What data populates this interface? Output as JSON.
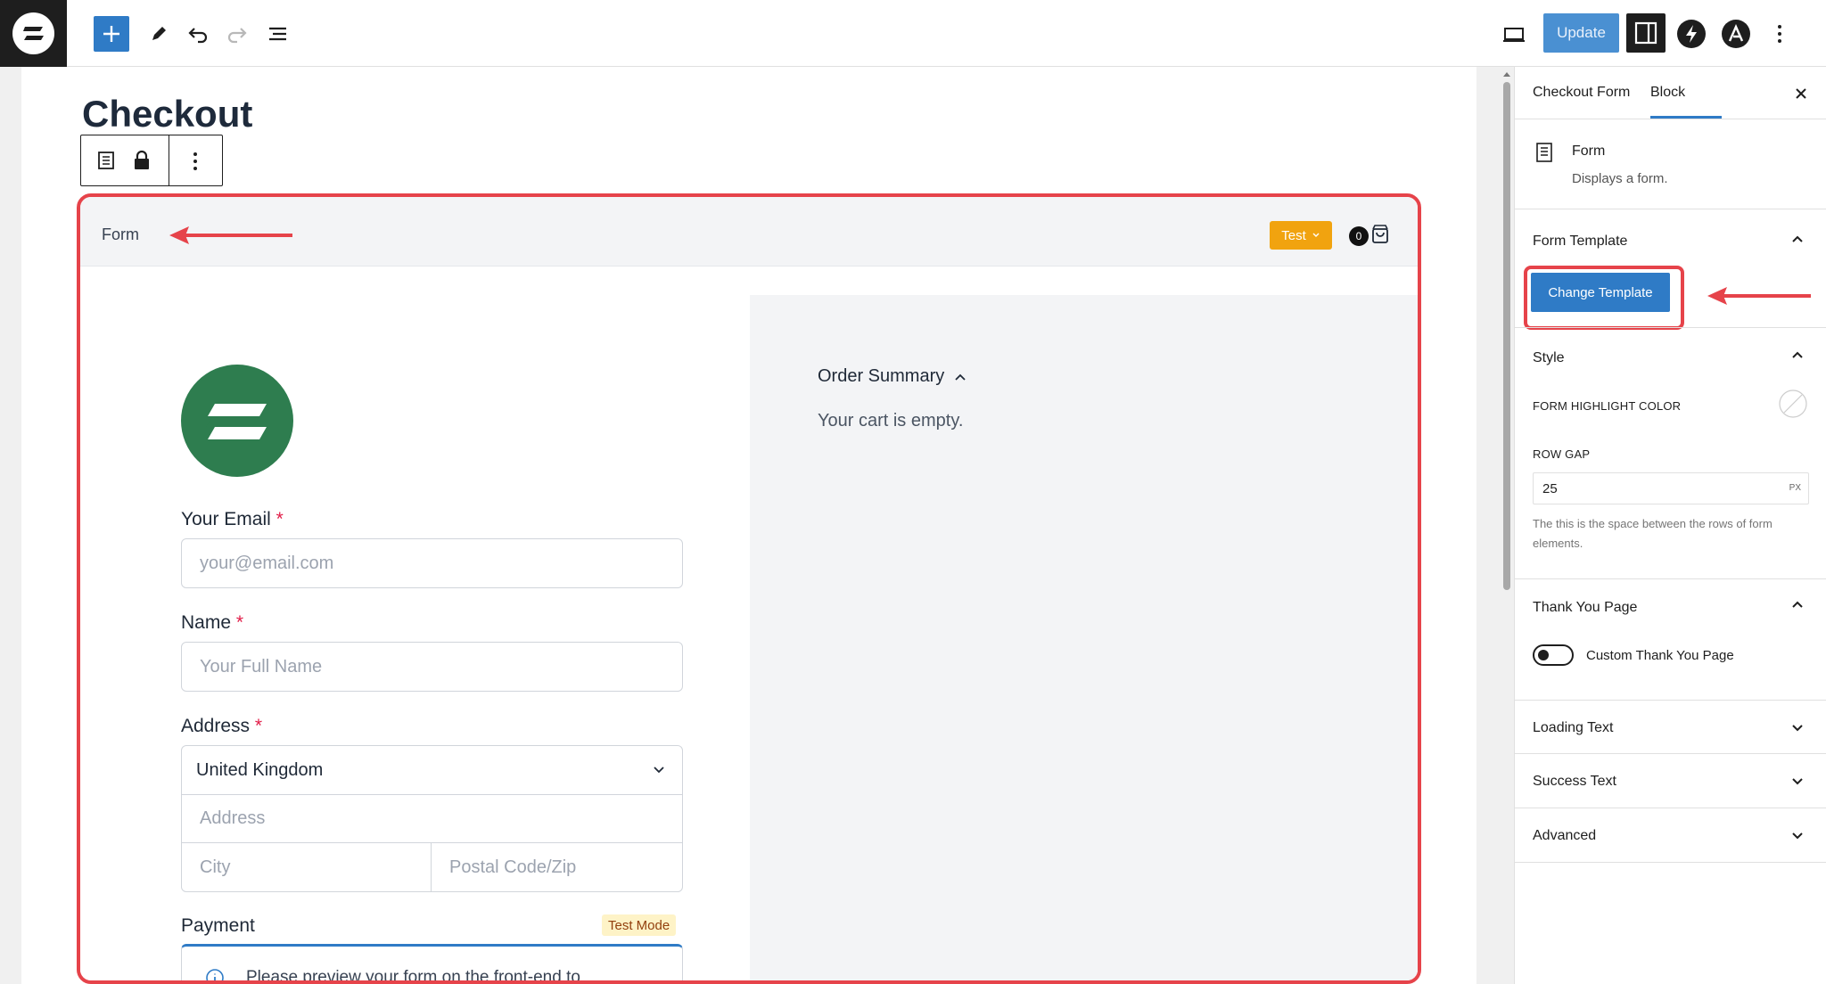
{
  "toolbar": {
    "update_label": "Update"
  },
  "editor": {
    "page_title": "Checkout"
  },
  "form_block": {
    "label": "Form",
    "mode_badge": "Test",
    "cart_count": "0",
    "brand_color": "#2e7d4f"
  },
  "fields": {
    "email": {
      "label": "Your Email",
      "required_mark": "*",
      "placeholder": "your@email.com"
    },
    "name": {
      "label": "Name",
      "required_mark": "*",
      "placeholder": "Your Full Name"
    },
    "address": {
      "label": "Address",
      "required_mark": "*",
      "country": "United Kingdom",
      "address_placeholder": "Address",
      "city_placeholder": "City",
      "postal_placeholder": "Postal Code/Zip"
    },
    "payment": {
      "label": "Payment",
      "badge": "Test Mode",
      "notice": "Please preview your form on the front-end to"
    }
  },
  "order_summary": {
    "title": "Order Summary",
    "empty_text": "Your cart is empty."
  },
  "sidebar": {
    "tabs": [
      "Checkout Form",
      "Block"
    ],
    "block_name": "Form",
    "block_description": "Displays a form.",
    "form_template": {
      "heading": "Form Template",
      "button": "Change Template"
    },
    "style": {
      "heading": "Style",
      "highlight_label": "FORM HIGHLIGHT COLOR",
      "row_gap_label": "ROW GAP",
      "row_gap_value": "25",
      "row_gap_unit": "PX",
      "help": "The this is the space between the rows of form elements."
    },
    "thank_you": {
      "heading": "Thank You Page",
      "toggle_label": "Custom Thank You Page"
    },
    "loading_text": "Loading Text",
    "success_text": "Success Text",
    "advanced": "Advanced"
  },
  "colors": {
    "accent_blue": "#2f7bc6",
    "highlight_red": "#e6434a",
    "test_orange": "#f1a30f"
  }
}
